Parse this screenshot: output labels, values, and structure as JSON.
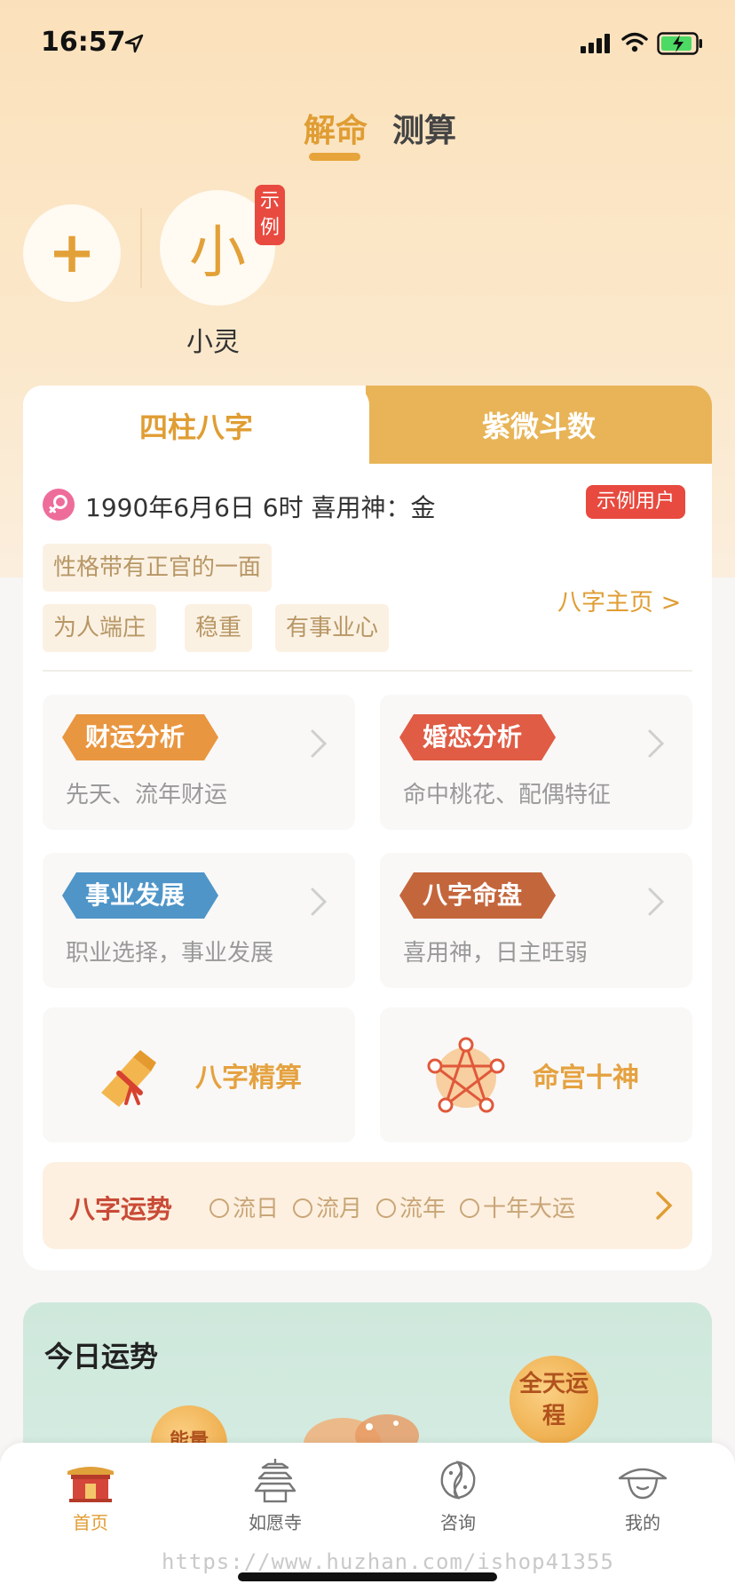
{
  "status_bar": {
    "time": "16:57"
  },
  "top_tabs": [
    {
      "label": "解命",
      "active": true
    },
    {
      "label": "测算",
      "active": false
    }
  ],
  "profiles": {
    "add_label": "+",
    "avatar_char": "小",
    "badge": "示例",
    "name": "小灵"
  },
  "card_tabs": [
    {
      "label": "四柱八字",
      "active": true
    },
    {
      "label": "紫微斗数",
      "active": false
    }
  ],
  "bazi": {
    "birth_info": "1990年6月6日 6时 喜用神：金",
    "demo_tag": "示例用户",
    "traits": [
      "性格带有正官的一面",
      "为人端庄",
      "稳重",
      "有事业心"
    ],
    "home_link": "八字主页 >"
  },
  "features": [
    {
      "title": "财运分析",
      "subtitle": "先天、流年财运",
      "color": "#e99640"
    },
    {
      "title": "婚恋分析",
      "subtitle": "命中桃花、配偶特征",
      "color": "#e05c45"
    },
    {
      "title": "事业发展",
      "subtitle": "职业选择，事业发展",
      "color": "#4f95c8"
    },
    {
      "title": "八字命盘",
      "subtitle": "喜用神，日主旺弱",
      "color": "#c4663c"
    }
  ],
  "big_features": [
    {
      "label": "八字精算",
      "icon": "scroll-icon"
    },
    {
      "label": "命宫十神",
      "icon": "pentagram-icon"
    }
  ],
  "fortune": {
    "title": "八字运势",
    "options": [
      "流日",
      "流月",
      "流年",
      "十年大运"
    ]
  },
  "today": {
    "title": "今日运势",
    "energy": "能量",
    "allday": "全天运程"
  },
  "nav": [
    {
      "label": "首页",
      "icon": "temple-icon",
      "active": true
    },
    {
      "label": "如愿寺",
      "icon": "pagoda-icon",
      "active": false
    },
    {
      "label": "咨询",
      "icon": "fish-icon",
      "active": false
    },
    {
      "label": "我的",
      "icon": "hat-icon",
      "active": false
    }
  ],
  "watermark": "https://www.huzhan.com/ishop41355",
  "colors": {
    "accent": "#e09d33",
    "red": "#e84a3f",
    "tab_bg": "#e8b457"
  }
}
